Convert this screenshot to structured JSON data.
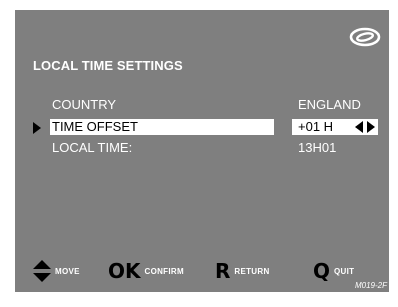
{
  "screen": {
    "title": "LOCAL TIME SETTINGS",
    "rows": [
      {
        "label": "COUNTRY",
        "value": "ENGLAND"
      },
      {
        "label": "TIME OFFSET",
        "value": "+01 H"
      },
      {
        "label": "LOCAL TIME:",
        "value": "13H01"
      }
    ],
    "selected_row": 1
  },
  "controls": [
    {
      "key": "",
      "label": "MOVE"
    },
    {
      "key": "OK",
      "label": "CONFIRM"
    },
    {
      "key": "R",
      "label": "RETURN"
    },
    {
      "key": "Q",
      "label": "QUIT"
    }
  ],
  "figure_code": "M019-2F",
  "icons": {
    "logo": "eye-logo-icon",
    "move": "up-down-arrows-icon",
    "adjust": "left-right-arrows-icon",
    "pointer": "selection-pointer-icon"
  },
  "colors": {
    "background": "#7f7f7f",
    "text": "#ffffff",
    "highlight": "#ffffff",
    "highlight_text": "#000000",
    "key": "#000000"
  }
}
